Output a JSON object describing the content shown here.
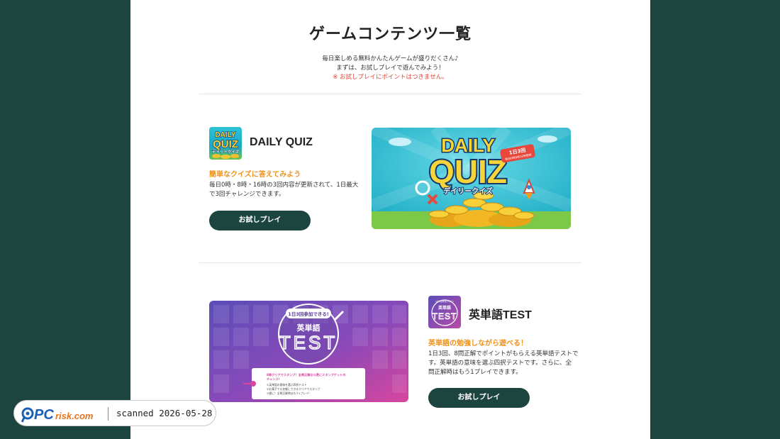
{
  "header": {
    "title": "ゲームコンテンツ一覧",
    "intro_line1": "毎日楽しめる無料かんたんゲームが盛りだくさん♪",
    "intro_line2": "まずは、お試しプレイで遊んでみよう！",
    "note": "※ お試しプレイにポイントはつきません。"
  },
  "games": [
    {
      "name": "DAILY QUIZ",
      "icon_text_top": "DAILY",
      "icon_text_main": "QUIZ",
      "icon_text_sub": "デイリークイズ",
      "catch": "簡単なクイズに答えてみよう",
      "desc_line1": "毎日0時・8時・16時の3回内容が更新されて、1日最大",
      "desc_line2": "で3回チャレンジできます。",
      "button": "お試しプレイ",
      "banner_daily": "DAILY",
      "banner_quiz": "QUIZ",
      "banner_sub": "デイリークイズ",
      "banner_badge_1": "1日3回",
      "banner_badge_2": "毎日0時8時16時更新"
    },
    {
      "name": "英単語TEST",
      "icon_text_top": "1日3回参加できる!",
      "icon_text_main": "英単語",
      "icon_text_sub": "TEST",
      "catch": "英単語の勉強しながら遊べる！",
      "desc_line1": "1日3回、8問正解でポイントがもらえる英単語テストで",
      "desc_line2": "す。英単語の意味を選ぶ四択テストです。さらに、全",
      "desc_line3": "問正解時はもう1プレイできます。",
      "button": "お試しプレイ",
      "banner_top": "1日3回参加できる!",
      "banner_main": "英単語",
      "banner_test": "TEST",
      "banner_card_title": "8問クリアでスタンプ！全問正解なら更にスタンプゲットの",
      "banner_card_title2": "チャンス！",
      "banner_card_l1": "①英単語の意味を選ぶ四択テスト",
      "banner_card_l2": "②お菓子でも気軽にできるクリアでスタンプ",
      "banner_card_l3": "③更に！全問正解時はもう1プレイ！"
    }
  ],
  "watermark": {
    "brand_pc": "PC",
    "brand_risk": "risk.com",
    "text": "scanned 2026-05-28"
  },
  "colors": {
    "background": "#1d4540",
    "button": "#1d4540",
    "accent_orange": "#f0921c",
    "note_red": "#e0473a"
  }
}
